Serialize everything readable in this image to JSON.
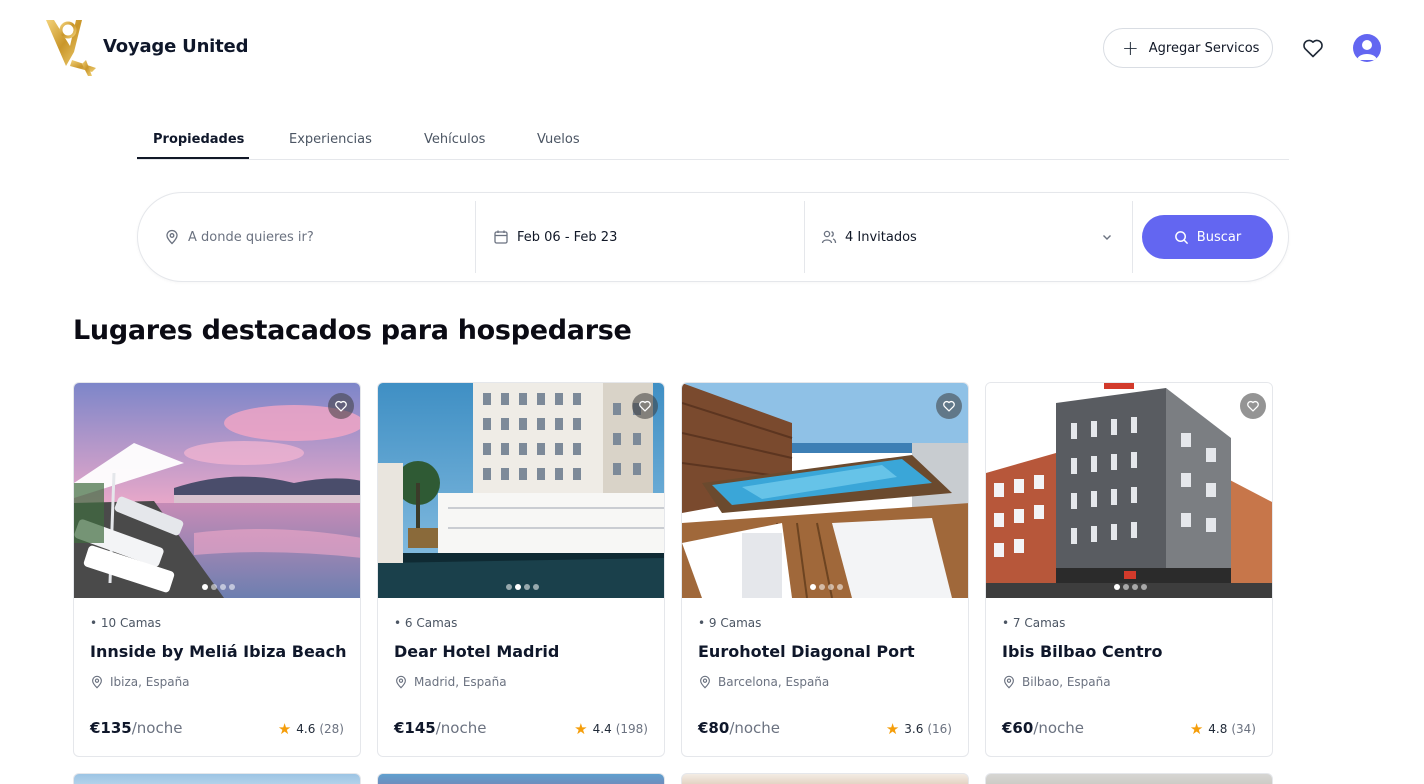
{
  "brand": {
    "name": "Voyage United"
  },
  "header": {
    "add_services_label": "Agregar Servicos",
    "add_icon": "plus-icon",
    "favorites_icon": "heart-icon",
    "avatar_icon": "user-avatar-icon"
  },
  "tabs": [
    {
      "label": "Propiedades",
      "active": true
    },
    {
      "label": "Experiencias",
      "active": false
    },
    {
      "label": "Vehículos",
      "active": false
    },
    {
      "label": "Vuelos",
      "active": false
    }
  ],
  "search": {
    "destination_placeholder": "A donde quieres ir?",
    "dates": "Feb 06 - Feb 23",
    "guests": "4 Invitados",
    "button_label": "Buscar"
  },
  "section": {
    "title": "Lugares destacados para hospedarse"
  },
  "properties": [
    {
      "beds": "• 10 Camas",
      "name": "Innside by Meliá Ibiza Beach",
      "location": "Ibiza, España",
      "price": "€135",
      "unit": "/noche",
      "rating": "4.6",
      "reviews": "(28)"
    },
    {
      "beds": "• 6 Camas",
      "name": "Dear Hotel Madrid",
      "location": "Madrid, España",
      "price": "€145",
      "unit": "/noche",
      "rating": "4.4",
      "reviews": "(198)"
    },
    {
      "beds": "• 9 Camas",
      "name": "Eurohotel Diagonal Port",
      "location": "Barcelona, España",
      "price": "€80",
      "unit": "/noche",
      "rating": "3.6",
      "reviews": "(16)"
    },
    {
      "beds": "• 7 Camas",
      "name": "Ibis Bilbao Centro",
      "location": "Bilbao, España",
      "price": "€60",
      "unit": "/noche",
      "rating": "4.8",
      "reviews": "(34)"
    }
  ],
  "colors": {
    "accent": "#6366f1",
    "star": "#f59e0b",
    "logo_gold": "#d4a72c"
  }
}
